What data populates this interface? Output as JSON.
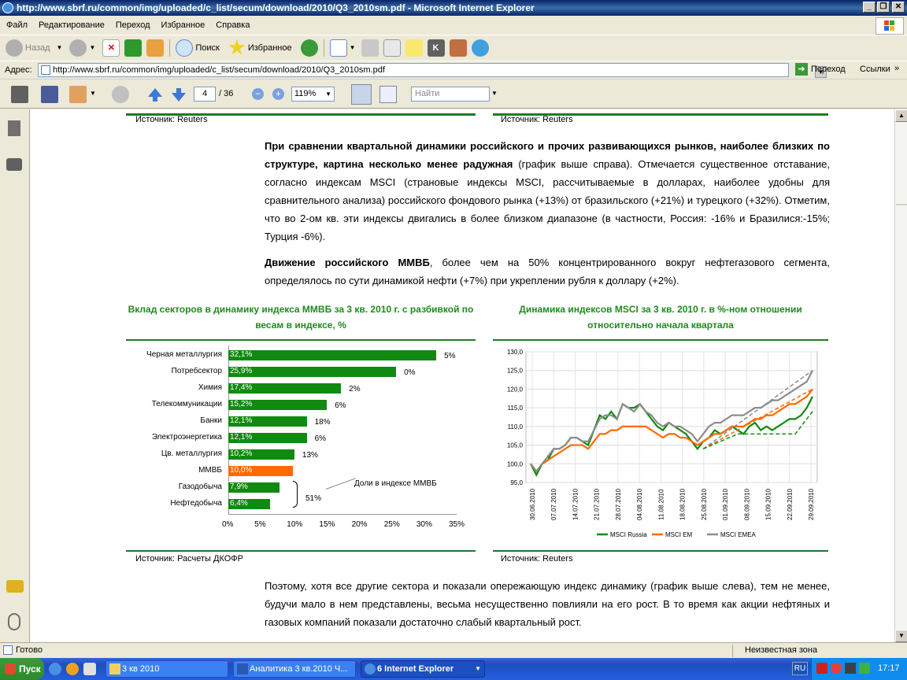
{
  "window": {
    "title": "http://www.sbrf.ru/common/img/uploaded/c_list/secum/download/2010/Q3_2010sm.pdf - Microsoft Internet Explorer"
  },
  "menu": [
    "Файл",
    "Редактирование",
    "Переход",
    "Избранное",
    "Справка"
  ],
  "toolbar": {
    "back": "Назад",
    "search": "Поиск",
    "favorites": "Избранное"
  },
  "address": {
    "label": "Адрес:",
    "url": "http://www.sbrf.ru/common/img/uploaded/c_list/secum/download/2010/Q3_2010sm.pdf",
    "go": "Переход",
    "links": "Ссылки"
  },
  "pdf": {
    "page": "4",
    "total": "/ 36",
    "zoom": "119%",
    "find_placeholder": "Найти"
  },
  "doc": {
    "source_left_top": "Источник: Reuters",
    "source_right_top": "Источник: Reuters",
    "p1_bold": "При сравнении квартальной динамики российского и прочих развивающихся рынков, наиболее близких по структуре, картина несколько менее радужная",
    "p1_rest": " (график выше справа). Отмечается существенное отставание, согласно индексам MSCI (страновые индексы MSCI, рассчитываемые в долларах, наиболее удобны для сравнительного анализа) российского фондового рынка (+13%) от бразильского (+21%) и турецкого (+32%). Отметим, что во 2-ом кв. эти индексы двигались в более близком диапазоне (в частности, Россия: -16% и Бразилися:-15%; Турция -6%).",
    "p2_bold": "Движение российского ММВБ",
    "p2_rest": ", более чем на 50% концентрированного вокруг нефтегазового сегмента, определялось по сути динамикой нефти (+7%) при укреплении рубля к доллару (+2%).",
    "chart1_title": "Вклад секторов в динамику индекса ММВБ за 3 кв. 2010 г. с разбивкой по весам в индексе, %",
    "chart2_title": "Динамика индексов MSCI за 3 кв. 2010 г. в %-ном отношении относительно начала квартала",
    "source_left_bottom": "Источник: Расчеты ДКОФР",
    "source_right_bottom": "Источник: Reuters",
    "p3": "Поэтому, хотя все другие сектора и показали опережающую индекс динамику (график выше слева), тем не менее, будучи мало в нем представлены, весьма несущественно повлияли на его рост. В то время как акции нефтяных и газовых компаний показали достаточно слабый квартальный рост.",
    "annotation": "Доли в индексе ММВБ",
    "annotation_value": "51%"
  },
  "chart_data": [
    {
      "type": "bar",
      "title": "Вклад секторов в динамику индекса ММВБ за 3 кв. 2010 г. с разбивкой по весам в индексе, %",
      "categories": [
        "Черная металлургия",
        "Потребсектор",
        "Химия",
        "Телекоммуникации",
        "Банки",
        "Электроэнергетика",
        "Цв. металлургия",
        "ММВБ",
        "Газодобыча",
        "Нефтедобыча"
      ],
      "values": [
        32.1,
        25.9,
        17.4,
        15.2,
        12.1,
        12.1,
        10.2,
        10.0,
        7.9,
        6.4
      ],
      "bar_labels": [
        "32,1%",
        "25,9%",
        "17,4%",
        "15,2%",
        "12,1%",
        "12,1%",
        "10,2%",
        "10,0%",
        "7,9%",
        "6,4%"
      ],
      "weights": [
        "5%",
        "0%",
        "2%",
        "6%",
        "18%",
        "6%",
        "13%",
        "",
        "",
        ""
      ],
      "highlight": "ММВБ",
      "xlim": [
        0,
        35
      ],
      "xticks": [
        "0%",
        "5%",
        "10%",
        "15%",
        "20%",
        "25%",
        "30%",
        "35%"
      ],
      "colors": {
        "bar": "#118a11",
        "highlight": "#ff6a00"
      }
    },
    {
      "type": "line",
      "title": "Динамика индексов MSCI за 3 кв. 2010 г. в %-ном отношении относительно начала квартала",
      "ylim": [
        95,
        130
      ],
      "yticks": [
        "95,0",
        "100,0",
        "105,0",
        "110,0",
        "115,0",
        "120,0",
        "125,0",
        "130,0"
      ],
      "xticks": [
        "30.06.2010",
        "07.07.2010",
        "14.07.2010",
        "21.07.2010",
        "28.07.2010",
        "04.08.2010",
        "11.08.2010",
        "18.08.2010",
        "25.08.2010",
        "01.09.2010",
        "08.09.2010",
        "15.09.2010",
        "22.09.2010",
        "29.09.2010"
      ],
      "series": [
        {
          "name": "MSCI Russia",
          "color": "#118a11",
          "values": [
            100,
            97,
            100,
            101,
            104,
            104,
            105,
            107,
            107,
            106,
            105,
            109,
            113,
            112,
            114,
            112,
            116,
            115,
            115,
            116,
            114,
            112,
            110,
            109,
            111,
            110,
            109,
            108,
            106,
            104,
            106,
            107,
            109,
            108,
            109,
            110,
            109,
            108,
            110,
            111,
            109,
            110,
            109,
            110,
            111,
            112,
            112,
            113,
            115,
            118
          ]
        },
        {
          "name": "MSCI EM",
          "color": "#ff6a00",
          "values": [
            100,
            98,
            100,
            101,
            102,
            103,
            104,
            105,
            105,
            105,
            104,
            106,
            108,
            108,
            109,
            109,
            110,
            110,
            110,
            110,
            110,
            109,
            108,
            107,
            108,
            108,
            107,
            107,
            106,
            105,
            106,
            107,
            108,
            108,
            109,
            110,
            110,
            110,
            111,
            112,
            112,
            113,
            113,
            114,
            115,
            116,
            116,
            117,
            118,
            120
          ]
        },
        {
          "name": "MSCI EMEA",
          "color": "#8c8c8c",
          "values": [
            100,
            98,
            100,
            102,
            104,
            104,
            105,
            107,
            107,
            106,
            106,
            109,
            112,
            113,
            113,
            112,
            116,
            115,
            114,
            116,
            114,
            113,
            111,
            110,
            111,
            110,
            110,
            109,
            108,
            106,
            108,
            110,
            111,
            111,
            112,
            113,
            113,
            113,
            114,
            115,
            115,
            116,
            117,
            117,
            118,
            119,
            120,
            121,
            122,
            125
          ]
        }
      ]
    }
  ],
  "status": {
    "left": "Готово",
    "zone": "Неизвестная зона"
  },
  "taskbar": {
    "start": "Пуск",
    "tasks": [
      "3 кв 2010",
      "Аналитика 3 кв.2010 Ч...",
      "6 Internet Explorer"
    ],
    "lang": "RU",
    "time": "17:17"
  }
}
